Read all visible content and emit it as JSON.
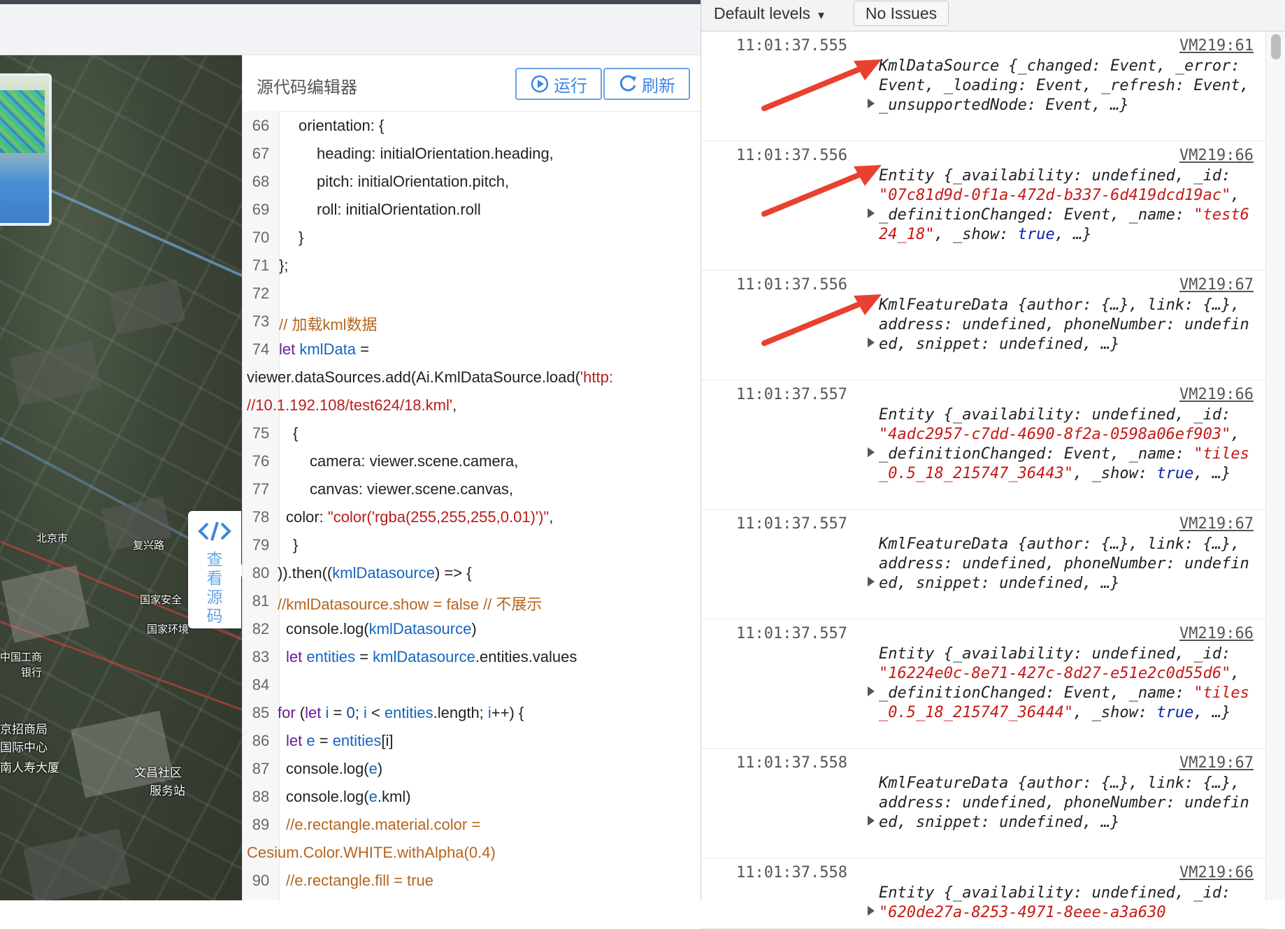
{
  "map": {
    "view_source_label": "查看源码",
    "labels": [
      "北京市",
      "复兴路",
      "国家安全",
      "国家环境",
      "中国工商",
      "银行",
      "京招商局",
      "国际中心",
      "文昌社区",
      "服务站",
      "南人寿大厦"
    ]
  },
  "editor": {
    "title": "源代码编辑器",
    "run_label": "运行",
    "refresh_label": "刷新",
    "lines": [
      {
        "n": "66",
        "indent": 80,
        "tokens": [
          {
            "t": "orientation: {",
            "c": ""
          }
        ]
      },
      {
        "n": "67",
        "indent": 106,
        "tokens": [
          {
            "t": "heading: initialOrientation.heading,",
            "c": ""
          }
        ]
      },
      {
        "n": "68",
        "indent": 106,
        "tokens": [
          {
            "t": "pitch: initialOrientation.pitch,",
            "c": ""
          }
        ]
      },
      {
        "n": "69",
        "indent": 106,
        "tokens": [
          {
            "t": "roll: initialOrientation.roll",
            "c": ""
          }
        ]
      },
      {
        "n": "70",
        "indent": 80,
        "tokens": [
          {
            "t": "}",
            "c": ""
          }
        ]
      },
      {
        "n": "71",
        "indent": 52,
        "tokens": [
          {
            "t": "};",
            "c": ""
          }
        ]
      },
      {
        "n": "72",
        "indent": 52,
        "tokens": []
      },
      {
        "n": "73",
        "indent": 52,
        "tokens": [
          {
            "t": "// 加载kml数据",
            "c": "cm"
          }
        ]
      },
      {
        "n": "74",
        "indent": 52,
        "tokens": [
          {
            "t": "let ",
            "c": "kw"
          },
          {
            "t": "kmlData",
            "c": "var"
          },
          {
            "t": " =",
            "c": ""
          }
        ]
      },
      {
        "n": "",
        "indent": 6,
        "tokens": [
          {
            "t": "viewer.dataSources.add(Ai.KmlDataSource.load(",
            "c": ""
          },
          {
            "t": "'http:",
            "c": "str"
          }
        ]
      },
      {
        "n": "",
        "indent": 6,
        "tokens": [
          {
            "t": "//10.1.192.108/test624/18.kml'",
            "c": "str"
          },
          {
            "t": ",",
            "c": ""
          }
        ]
      },
      {
        "n": "75",
        "indent": 72,
        "tokens": [
          {
            "t": "{",
            "c": ""
          }
        ]
      },
      {
        "n": "76",
        "indent": 96,
        "tokens": [
          {
            "t": "camera: viewer.scene.camera,",
            "c": ""
          }
        ]
      },
      {
        "n": "77",
        "indent": 96,
        "tokens": [
          {
            "t": "canvas: viewer.scene.canvas,",
            "c": ""
          }
        ]
      },
      {
        "n": "78",
        "indent": 62,
        "tokens": [
          {
            "t": "color: ",
            "c": ""
          },
          {
            "t": "\"color('rgba(255,255,255,0.01)')\"",
            "c": "str"
          },
          {
            "t": ",",
            "c": ""
          }
        ]
      },
      {
        "n": "79",
        "indent": 72,
        "tokens": [
          {
            "t": "}",
            "c": ""
          }
        ]
      },
      {
        "n": "80",
        "indent": 50,
        "tokens": [
          {
            "t": ")).then((",
            "c": ""
          },
          {
            "t": "kmlDatasource",
            "c": "var"
          },
          {
            "t": ") => {",
            "c": ""
          }
        ]
      },
      {
        "n": "81",
        "indent": 50,
        "tokens": [
          {
            "t": "//kmlDatasource.show = false // 不展示",
            "c": "cm"
          }
        ]
      },
      {
        "n": "82",
        "indent": 62,
        "tokens": [
          {
            "t": "console.log(",
            "c": ""
          },
          {
            "t": "kmlDatasource",
            "c": "var"
          },
          {
            "t": ")",
            "c": ""
          }
        ]
      },
      {
        "n": "83",
        "indent": 62,
        "tokens": [
          {
            "t": "let ",
            "c": "kw"
          },
          {
            "t": "entities",
            "c": "var"
          },
          {
            "t": " = ",
            "c": ""
          },
          {
            "t": "kmlDatasource",
            "c": "var"
          },
          {
            "t": ".entities.values",
            "c": ""
          }
        ]
      },
      {
        "n": "84",
        "indent": 62,
        "tokens": []
      },
      {
        "n": "85",
        "indent": 50,
        "tokens": [
          {
            "t": "for ",
            "c": "kw"
          },
          {
            "t": "(",
            "c": ""
          },
          {
            "t": "let ",
            "c": "kw"
          },
          {
            "t": "i",
            "c": "var"
          },
          {
            "t": " = ",
            "c": ""
          },
          {
            "t": "0",
            "c": "num"
          },
          {
            "t": "; ",
            "c": ""
          },
          {
            "t": "i",
            "c": "var"
          },
          {
            "t": " < ",
            "c": ""
          },
          {
            "t": "entities",
            "c": "var"
          },
          {
            "t": ".length; ",
            "c": ""
          },
          {
            "t": "i",
            "c": "var"
          },
          {
            "t": "++) {",
            "c": ""
          }
        ]
      },
      {
        "n": "86",
        "indent": 62,
        "tokens": [
          {
            "t": "let ",
            "c": "kw"
          },
          {
            "t": "e",
            "c": "var"
          },
          {
            "t": " = ",
            "c": ""
          },
          {
            "t": "entities",
            "c": "var"
          },
          {
            "t": "[i]",
            "c": ""
          }
        ]
      },
      {
        "n": "87",
        "indent": 62,
        "tokens": [
          {
            "t": "console.log(",
            "c": ""
          },
          {
            "t": "e",
            "c": "var"
          },
          {
            "t": ")",
            "c": ""
          }
        ]
      },
      {
        "n": "88",
        "indent": 62,
        "tokens": [
          {
            "t": "console.log(",
            "c": ""
          },
          {
            "t": "e",
            "c": "var"
          },
          {
            "t": ".kml)",
            "c": ""
          }
        ]
      },
      {
        "n": "89",
        "indent": 62,
        "tokens": [
          {
            "t": "//e.rectangle.material.color =",
            "c": "cm"
          }
        ]
      },
      {
        "n": "",
        "indent": 6,
        "tokens": [
          {
            "t": "Cesium.Color.WHITE.withAlpha(0.4)",
            "c": "cm"
          }
        ]
      },
      {
        "n": "90",
        "indent": 62,
        "tokens": [
          {
            "t": "//e.rectangle.fill = true",
            "c": "cm"
          }
        ]
      }
    ]
  },
  "console": {
    "levels_label": "Default levels",
    "issues_label": "No Issues",
    "entries": [
      {
        "time": "11:01:37.555",
        "src": "VM219:61",
        "html": "KmlDataSource {<i>_changed</i>: Event, <i>_error</i>: Event, <i>_loading</i>: Event, <i>_refresh</i>: Event, <i>_unsupportedNode</i>: Event, …}",
        "lines": 4,
        "arrow": true
      },
      {
        "time": "11:01:37.556",
        "src": "VM219:66",
        "html": "Entity {_availability: undefined, _id: <span class='s'>\"07c81d9d-0f1a-472d-b337-6d419dcd19ac\"</span>, _definitionChanged: Event, _name: <span class='s'>\"test624_18\"</span>, _show: <span class='b'>true</span>, …}",
        "lines": 5,
        "arrow": true
      },
      {
        "time": "11:01:37.556",
        "src": "VM219:67",
        "html": "KmlFeatureData {author: {…}, link: {…}, address: undefined, phoneNumber: undefined, snippet: undefined, …}",
        "lines": 4,
        "arrow": true
      },
      {
        "time": "11:01:37.557",
        "src": "VM219:66",
        "html": "Entity {_availability: undefined, _id: <span class='s'>\"4adc2957-c7dd-4690-8f2a-0598a06ef903\"</span>, _definitionChanged: Event, _name: <span class='s'>\"tiles_0.5_18_215747_36443\"</span>, _show: <span class='b'>true</span>, …}",
        "lines": 5,
        "arrow": false
      },
      {
        "time": "11:01:37.557",
        "src": "VM219:67",
        "html": "KmlFeatureData {author: {…}, link: {…}, address: undefined, phoneNumber: undefined, snippet: undefined, …}",
        "lines": 4,
        "arrow": false
      },
      {
        "time": "11:01:37.557",
        "src": "VM219:66",
        "html": "Entity {_availability: undefined, _id: <span class='s'>\"16224e0c-8e71-427c-8d27-e51e2c0d55d6\"</span>, _definitionChanged: Event, _name: <span class='s'>\"tiles_0.5_18_215747_36444\"</span>, _show: <span class='b'>true</span>, …}",
        "lines": 5,
        "arrow": false
      },
      {
        "time": "11:01:37.558",
        "src": "VM219:67",
        "html": "KmlFeatureData {author: {…}, link: {…}, address: undefined, phoneNumber: undefined, snippet: undefined, …}",
        "lines": 4,
        "arrow": false
      },
      {
        "time": "11:01:37.558",
        "src": "VM219:66",
        "html": "Entity {_availability: undefined, _id: <span class='s'>\"620de27a-8253-4971-8eee-a3a630</span>",
        "lines": 2,
        "arrow": false
      }
    ]
  },
  "colors": {
    "accent": "#3f86e0",
    "annotation": "#e8412f",
    "string": "#c41a16"
  }
}
